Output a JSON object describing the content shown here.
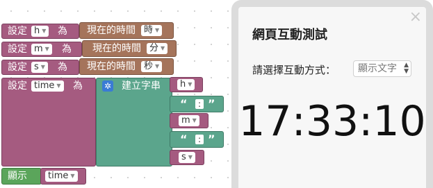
{
  "blocks": {
    "set_h": {
      "keyword": "設定",
      "var": "h",
      "to": "為",
      "func": "現在的時間",
      "unit": "時"
    },
    "set_m": {
      "keyword": "設定",
      "var": "m",
      "to": "為",
      "func": "現在的時間",
      "unit": "分"
    },
    "set_s": {
      "keyword": "設定",
      "var": "s",
      "to": "為",
      "func": "現在的時間",
      "unit": "秒"
    },
    "set_time": {
      "keyword": "設定",
      "var": "time",
      "to": "為",
      "func": "建立字串",
      "parts": [
        {
          "kind": "var",
          "value": "h"
        },
        {
          "kind": "string",
          "value": ":"
        },
        {
          "kind": "var",
          "value": "m"
        },
        {
          "kind": "string",
          "value": ":"
        },
        {
          "kind": "var",
          "value": "s"
        }
      ]
    },
    "display": {
      "keyword": "顯示",
      "var": "time"
    }
  },
  "panel": {
    "title": "網頁互動測試",
    "close": "×",
    "prompt_label": "請選擇互動方式：",
    "mode_select": "顯示文字",
    "clock": "17:33:10"
  },
  "colors": {
    "variable_block": "#a55b80",
    "time_block": "#a5745b",
    "text_block": "#5ba58c",
    "output_block": "#5ba55b"
  }
}
